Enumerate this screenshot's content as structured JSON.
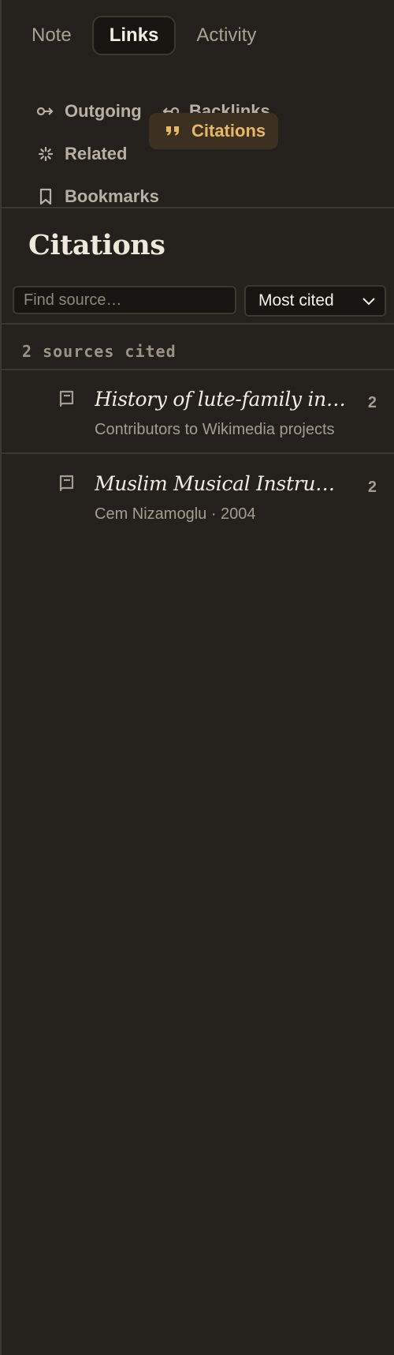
{
  "tabs": [
    {
      "label": "Note",
      "active": false
    },
    {
      "label": "Links",
      "active": true
    },
    {
      "label": "Activity",
      "active": false
    }
  ],
  "subnav": {
    "outgoing": {
      "label": "Outgoing",
      "icon": "outgoing-link-icon"
    },
    "backlinks": {
      "label": "Backlinks",
      "icon": "backlink-icon"
    },
    "related": {
      "label": "Related",
      "icon": "sparkle-icon"
    },
    "citations": {
      "label": "Citations",
      "icon": "quote-icon",
      "active": true
    },
    "bookmarks": {
      "label": "Bookmarks",
      "icon": "bookmark-icon"
    }
  },
  "panel": {
    "heading": "Citations",
    "search_placeholder": "Find source…",
    "search_value": "",
    "sort_value": "Most cited",
    "count_label": "2 sources cited"
  },
  "sources": [
    {
      "title": "History of lute-family instruments",
      "meta": "Contributors to Wikimedia projects",
      "count": "2",
      "icon": "book-icon"
    },
    {
      "title": "Muslim Musical Instruments",
      "meta": "Cem Nizamoglu · 2004",
      "count": "2",
      "icon": "book-icon"
    }
  ],
  "colors": {
    "background": "#24211c",
    "accent": "#e8b667",
    "accent_bg": "#3c3120"
  }
}
